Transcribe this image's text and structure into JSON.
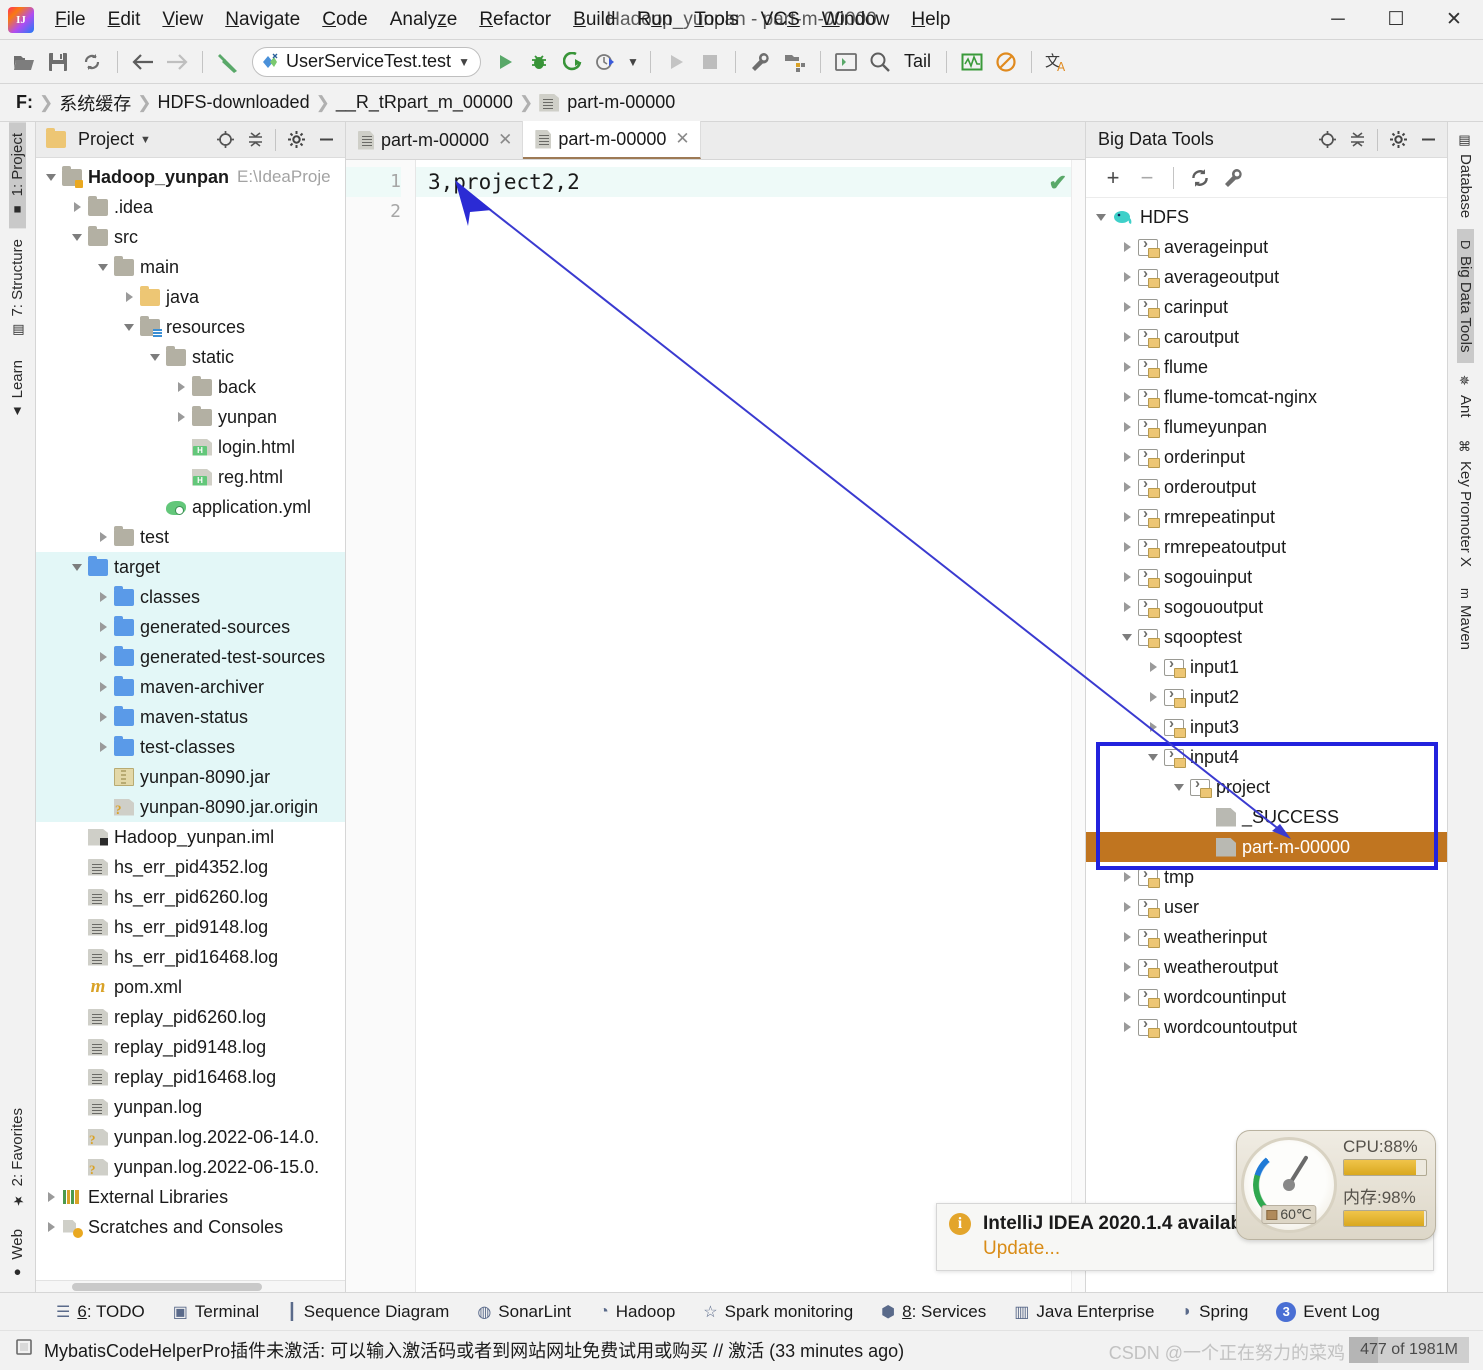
{
  "window": {
    "title": "Hadoop_yunpan - part-m-00000",
    "minimize": "─",
    "maximize": "☐",
    "close": "✕"
  },
  "menubar": {
    "items": [
      "File",
      "Edit",
      "View",
      "Navigate",
      "Code",
      "Analyze",
      "Refactor",
      "Build",
      "Run",
      "Tools",
      "VCS",
      "Window",
      "Help"
    ]
  },
  "toolbar": {
    "open_icon": "open-folder-icon",
    "save_icon": "save-icon",
    "sync_icon": "sync-icon",
    "back_icon": "back-arrow-icon",
    "forward_icon": "forward-arrow-icon",
    "build_icon": "build-hammer-icon",
    "run_config": "UserServiceTest.test",
    "run_icon": "run-icon",
    "debug_icon": "debug-icon",
    "run_coverage_icon": "run-with-coverage-icon",
    "profile_icon": "profiler-icon",
    "stop_icon": "stop-icon",
    "settings_icon": "wrench-icon",
    "project_structure_icon": "project-structure-icon",
    "terminal_icon": "terminal-icon",
    "search_icon": "search-everywhere-icon",
    "tail_label": "Tail",
    "monitor_icon": "monitor-icon",
    "no_icon": "block-icon",
    "translate_icon": "translate-icon"
  },
  "breadcrumb": {
    "items": [
      "F:",
      "系统缓存",
      "HDFS-downloaded",
      "__R_tRpart_m_00000",
      "part-m-00000"
    ]
  },
  "left_strip": {
    "top": [
      {
        "label": "1: Project",
        "icon": "project-icon",
        "active": true
      },
      {
        "label": "7: Structure",
        "icon": "structure-icon",
        "active": false
      },
      {
        "label": "Learn",
        "icon": "graduation-cap-icon",
        "active": false
      }
    ],
    "bottom": [
      {
        "label": "2: Favorites",
        "icon": "star-icon",
        "active": false
      },
      {
        "label": "Web",
        "icon": "globe-icon",
        "active": false
      }
    ]
  },
  "right_strip": {
    "items": [
      {
        "label": "Database",
        "icon": "database-icon",
        "active": false
      },
      {
        "label": "Big Data Tools",
        "icon": "big-data-tools-icon",
        "active": true
      },
      {
        "label": "Ant",
        "icon": "ant-icon",
        "active": false
      },
      {
        "label": "Key Promoter X",
        "icon": "key-promoter-icon",
        "active": false
      },
      {
        "label": "Maven",
        "icon": "maven-icon",
        "active": false
      }
    ]
  },
  "project_panel": {
    "title": "Project",
    "dropdown_icon": "chevron-down-icon",
    "locate_icon": "locate-target-icon",
    "collapse_icon": "collapse-all-icon",
    "settings_icon": "gear-icon",
    "hide_icon": "minimize-icon",
    "tree": [
      {
        "label": "Hadoop_yunpan",
        "path": "E:\\IdeaProje",
        "indent": 0,
        "arrow": "open",
        "icon": "folder-mod",
        "bold": true,
        "hl": false
      },
      {
        "label": ".idea",
        "indent": 1,
        "arrow": "closed",
        "icon": "folder",
        "hl": false
      },
      {
        "label": "src",
        "indent": 1,
        "arrow": "open",
        "icon": "folder",
        "hl": false
      },
      {
        "label": "main",
        "indent": 2,
        "arrow": "open",
        "icon": "folder",
        "hl": false
      },
      {
        "label": "java",
        "indent": 3,
        "arrow": "closed",
        "icon": "folder-yellow",
        "hl": false
      },
      {
        "label": "resources",
        "indent": 3,
        "arrow": "open",
        "icon": "folder-res",
        "hl": false
      },
      {
        "label": "static",
        "indent": 4,
        "arrow": "open",
        "icon": "folder",
        "hl": false
      },
      {
        "label": "back",
        "indent": 5,
        "arrow": "closed",
        "icon": "folder",
        "hl": false
      },
      {
        "label": "yunpan",
        "indent": 5,
        "arrow": "closed",
        "icon": "folder",
        "hl": false
      },
      {
        "label": "login.html",
        "indent": 5,
        "arrow": "none",
        "icon": "file-html",
        "hl": false
      },
      {
        "label": "reg.html",
        "indent": 5,
        "arrow": "none",
        "icon": "file-html",
        "hl": false
      },
      {
        "label": "application.yml",
        "indent": 4,
        "arrow": "none",
        "icon": "yml",
        "hl": false
      },
      {
        "label": "test",
        "indent": 2,
        "arrow": "closed",
        "icon": "folder",
        "hl": false
      },
      {
        "label": "target",
        "indent": 1,
        "arrow": "open",
        "icon": "folder-blue",
        "hl": true
      },
      {
        "label": "classes",
        "indent": 2,
        "arrow": "closed",
        "icon": "folder-blue",
        "hl": true
      },
      {
        "label": "generated-sources",
        "indent": 2,
        "arrow": "closed",
        "icon": "folder-blue",
        "hl": true
      },
      {
        "label": "generated-test-sources",
        "indent": 2,
        "arrow": "closed",
        "icon": "folder-blue",
        "hl": true
      },
      {
        "label": "maven-archiver",
        "indent": 2,
        "arrow": "closed",
        "icon": "folder-blue",
        "hl": true
      },
      {
        "label": "maven-status",
        "indent": 2,
        "arrow": "closed",
        "icon": "folder-blue",
        "hl": true
      },
      {
        "label": "test-classes",
        "indent": 2,
        "arrow": "closed",
        "icon": "folder-blue",
        "hl": true
      },
      {
        "label": "yunpan-8090.jar",
        "indent": 2,
        "arrow": "none",
        "icon": "jar",
        "hl": true
      },
      {
        "label": "yunpan-8090.jar.origin",
        "indent": 2,
        "arrow": "none",
        "icon": "unknown",
        "hl": true
      },
      {
        "label": "Hadoop_yunpan.iml",
        "indent": 1,
        "arrow": "none",
        "icon": "iml",
        "hl": false
      },
      {
        "label": "hs_err_pid4352.log",
        "indent": 1,
        "arrow": "none",
        "icon": "file",
        "hl": false
      },
      {
        "label": "hs_err_pid6260.log",
        "indent": 1,
        "arrow": "none",
        "icon": "file",
        "hl": false
      },
      {
        "label": "hs_err_pid9148.log",
        "indent": 1,
        "arrow": "none",
        "icon": "file",
        "hl": false
      },
      {
        "label": "hs_err_pid16468.log",
        "indent": 1,
        "arrow": "none",
        "icon": "file",
        "hl": false
      },
      {
        "label": "pom.xml",
        "indent": 1,
        "arrow": "none",
        "icon": "maven-m",
        "hl": false
      },
      {
        "label": "replay_pid6260.log",
        "indent": 1,
        "arrow": "none",
        "icon": "file",
        "hl": false
      },
      {
        "label": "replay_pid9148.log",
        "indent": 1,
        "arrow": "none",
        "icon": "file",
        "hl": false
      },
      {
        "label": "replay_pid16468.log",
        "indent": 1,
        "arrow": "none",
        "icon": "file",
        "hl": false
      },
      {
        "label": "yunpan.log",
        "indent": 1,
        "arrow": "none",
        "icon": "file",
        "hl": false
      },
      {
        "label": "yunpan.log.2022-06-14.0.",
        "indent": 1,
        "arrow": "none",
        "icon": "unknown",
        "hl": false
      },
      {
        "label": "yunpan.log.2022-06-15.0.",
        "indent": 1,
        "arrow": "none",
        "icon": "unknown",
        "hl": false
      },
      {
        "label": "External Libraries",
        "indent": 0,
        "arrow": "closed",
        "icon": "lib",
        "hl": false
      },
      {
        "label": "Scratches and Consoles",
        "indent": 0,
        "arrow": "closed",
        "icon": "scratch",
        "hl": false
      }
    ]
  },
  "editor": {
    "tabs": [
      {
        "label": "part-m-00000",
        "icon": "file-icon",
        "active": false,
        "close_icon": "close-icon"
      },
      {
        "label": "part-m-00000",
        "icon": "file-icon",
        "active": true,
        "close_icon": "close-icon"
      }
    ],
    "lines": [
      {
        "num": "1",
        "text": "3,project2,2"
      },
      {
        "num": "2",
        "text": ""
      }
    ],
    "inspection_status_icon": "checkmark-ok-icon"
  },
  "bdt_panel": {
    "title": "Big Data Tools",
    "locate_icon": "locate-target-icon",
    "collapse_icon": "collapse-all-icon",
    "settings_icon": "gear-icon",
    "hide_icon": "minimize-icon",
    "toolbar": {
      "add": "+",
      "remove": "−",
      "refresh_icon": "refresh-icon",
      "configure_icon": "wrench-icon"
    },
    "tree": [
      {
        "label": "HDFS",
        "indent": 0,
        "arrow": "open",
        "icon": "elephant",
        "selected": false
      },
      {
        "label": "averageinput",
        "indent": 1,
        "arrow": "closed",
        "icon": "hdfs-folder",
        "selected": false
      },
      {
        "label": "averageoutput",
        "indent": 1,
        "arrow": "closed",
        "icon": "hdfs-folder",
        "selected": false
      },
      {
        "label": "carinput",
        "indent": 1,
        "arrow": "closed",
        "icon": "hdfs-folder",
        "selected": false
      },
      {
        "label": "caroutput",
        "indent": 1,
        "arrow": "closed",
        "icon": "hdfs-folder",
        "selected": false
      },
      {
        "label": "flume",
        "indent": 1,
        "arrow": "closed",
        "icon": "hdfs-folder",
        "selected": false
      },
      {
        "label": "flume-tomcat-nginx",
        "indent": 1,
        "arrow": "closed",
        "icon": "hdfs-folder",
        "selected": false
      },
      {
        "label": "flumeyunpan",
        "indent": 1,
        "arrow": "closed",
        "icon": "hdfs-folder",
        "selected": false
      },
      {
        "label": "orderinput",
        "indent": 1,
        "arrow": "closed",
        "icon": "hdfs-folder",
        "selected": false
      },
      {
        "label": "orderoutput",
        "indent": 1,
        "arrow": "closed",
        "icon": "hdfs-folder",
        "selected": false
      },
      {
        "label": "rmrepeatinput",
        "indent": 1,
        "arrow": "closed",
        "icon": "hdfs-folder",
        "selected": false
      },
      {
        "label": "rmrepeatoutput",
        "indent": 1,
        "arrow": "closed",
        "icon": "hdfs-folder",
        "selected": false
      },
      {
        "label": "sogouinput",
        "indent": 1,
        "arrow": "closed",
        "icon": "hdfs-folder",
        "selected": false
      },
      {
        "label": "sogououtput",
        "indent": 1,
        "arrow": "closed",
        "icon": "hdfs-folder",
        "selected": false
      },
      {
        "label": "sqooptest",
        "indent": 1,
        "arrow": "open",
        "icon": "hdfs-folder",
        "selected": false
      },
      {
        "label": "input1",
        "indent": 2,
        "arrow": "closed",
        "icon": "hdfs-folder",
        "selected": false
      },
      {
        "label": "input2",
        "indent": 2,
        "arrow": "closed",
        "icon": "hdfs-folder",
        "selected": false
      },
      {
        "label": "input3",
        "indent": 2,
        "arrow": "closed",
        "icon": "hdfs-folder",
        "selected": false
      },
      {
        "label": "input4",
        "indent": 2,
        "arrow": "open",
        "icon": "hdfs-folder",
        "selected": false
      },
      {
        "label": "project",
        "indent": 3,
        "arrow": "open",
        "icon": "hdfs-folder",
        "selected": false
      },
      {
        "label": "_SUCCESS",
        "indent": 4,
        "arrow": "none",
        "icon": "hdfs-file",
        "selected": false
      },
      {
        "label": "part-m-00000",
        "indent": 4,
        "arrow": "none",
        "icon": "hdfs-file",
        "selected": true
      },
      {
        "label": "tmp",
        "indent": 1,
        "arrow": "closed",
        "icon": "hdfs-folder",
        "selected": false
      },
      {
        "label": "user",
        "indent": 1,
        "arrow": "closed",
        "icon": "hdfs-folder",
        "selected": false
      },
      {
        "label": "weatherinput",
        "indent": 1,
        "arrow": "closed",
        "icon": "hdfs-folder",
        "selected": false
      },
      {
        "label": "weatheroutput",
        "indent": 1,
        "arrow": "closed",
        "icon": "hdfs-folder",
        "selected": false
      },
      {
        "label": "wordcountinput",
        "indent": 1,
        "arrow": "closed",
        "icon": "hdfs-folder",
        "selected": false
      },
      {
        "label": "wordcountoutput",
        "indent": 1,
        "arrow": "closed",
        "icon": "hdfs-folder",
        "selected": false
      }
    ]
  },
  "annotation": {
    "box_color": "#2222dd",
    "arrow_color": "#2b2bd4",
    "selection_color": "#c07520"
  },
  "notification": {
    "icon": "info-icon",
    "title": "IntelliJ IDEA 2020.1.4 available",
    "link": "Update..."
  },
  "performance": {
    "temperature": "60℃",
    "temp_icon": "hdd-icon",
    "cpu_label": "CPU:88%",
    "cpu_percent": 88,
    "memory_label": "内存:98%",
    "memory_percent": 98
  },
  "bottom_tools": [
    {
      "label": "6: TODO",
      "icon": "todo-list-icon",
      "mnemonic": "6"
    },
    {
      "label": "Terminal",
      "icon": "terminal-icon",
      "mnemonic": ""
    },
    {
      "label": "Sequence Diagram",
      "icon": "sequence-diagram-icon",
      "mnemonic": ""
    },
    {
      "label": "SonarLint",
      "icon": "sonarlint-icon",
      "mnemonic": ""
    },
    {
      "label": "Hadoop",
      "icon": "hadoop-elephant-icon",
      "mnemonic": ""
    },
    {
      "label": "Spark monitoring",
      "icon": "star-icon",
      "mnemonic": ""
    },
    {
      "label": "8: Services",
      "icon": "services-icon",
      "mnemonic": "8"
    },
    {
      "label": "Java Enterprise",
      "icon": "java-enterprise-icon",
      "mnemonic": ""
    },
    {
      "label": "Spring",
      "icon": "spring-leaf-icon",
      "mnemonic": ""
    },
    {
      "label": "Event Log",
      "icon": "event-log-icon",
      "badge": "3"
    }
  ],
  "statusbar": {
    "icon": "plugin-icon",
    "message": "MybatisCodeHelperPro插件未激活: 可以输入激活码或者到网站网址免费试用或购买 // 激活 (33 minutes ago)",
    "watermark": "CSDN @一个正在努力的菜鸡",
    "memory": "477 of 1981M"
  }
}
